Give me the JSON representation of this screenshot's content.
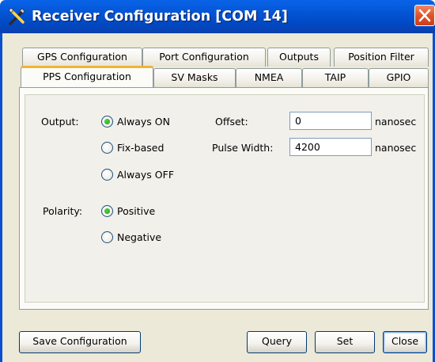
{
  "window": {
    "title": "Receiver Configuration [COM 14]",
    "title_icon": "tools-icon",
    "close_icon": "close-icon"
  },
  "tabs": {
    "row1": [
      "GPS Configuration",
      "Port Configuration",
      "Outputs",
      "Position Filter"
    ],
    "row2": [
      "PPS Configuration",
      "SV Masks",
      "NMEA",
      "TAIP",
      "GPIO"
    ],
    "active": "PPS Configuration"
  },
  "pps": {
    "output_label": "Output:",
    "output_options": [
      "Always ON",
      "Fix-based",
      "Always OFF"
    ],
    "output_selected": "Always ON",
    "offset_label": "Offset:",
    "offset_value": "0",
    "offset_unit": "nanosec",
    "pulse_width_label": "Pulse Width:",
    "pulse_width_value": "4200",
    "pulse_width_unit": "nanosec",
    "polarity_label": "Polarity:",
    "polarity_options": [
      "Positive",
      "Negative"
    ],
    "polarity_selected": "Positive"
  },
  "buttons": {
    "save": "Save Configuration",
    "query": "Query",
    "set": "Set",
    "close": "Close"
  },
  "colors": {
    "titlebar": "#0456d6",
    "active_tab_accent": "#f0b433",
    "radio_dot": "#1f9a16",
    "close_button": "#e0532a"
  }
}
